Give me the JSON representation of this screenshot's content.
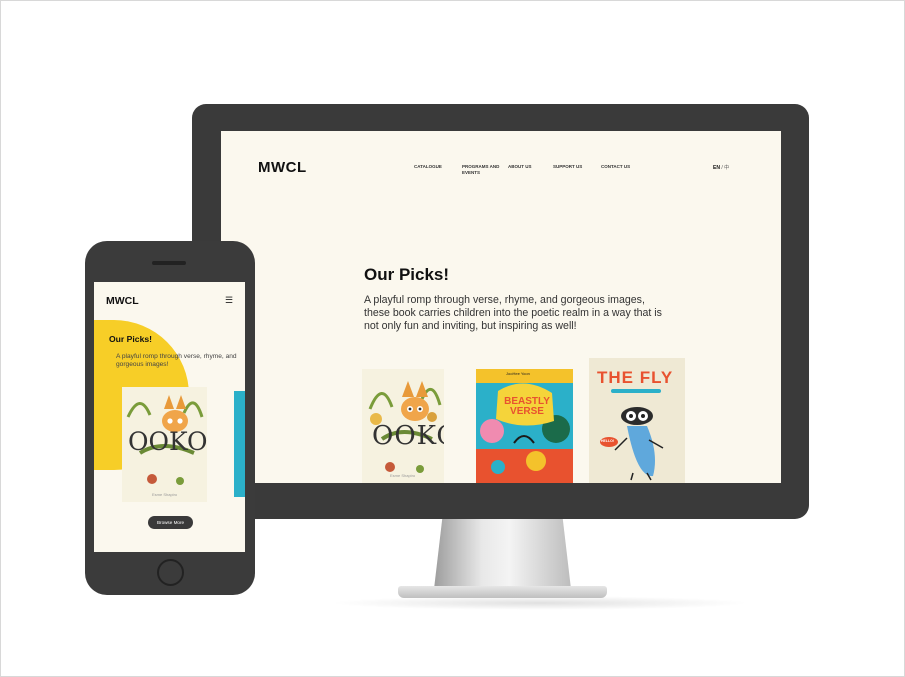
{
  "desktop": {
    "logo": "MWCL",
    "nav": [
      "CATALOGUE",
      "PROGRAMS AND EVENTS",
      "ABOUT US",
      "SUPPORT US",
      "CONTACT US"
    ],
    "lang_active": "EN",
    "lang_other": "/ 中",
    "title": "Our Picks!",
    "description": "A playful romp through verse, rhyme, and gorgeous images, these book carries children into the poetic realm in a way that is not only fun and inviting, but inspiring as well!",
    "books": [
      {
        "title": "OOKO",
        "author": "Esme Shapiro"
      },
      {
        "title": "BEASTLY VERSE",
        "author": "JooHee Yoon"
      },
      {
        "title": "THE FLY",
        "sticker": "HELLO!"
      }
    ]
  },
  "mobile": {
    "logo": "MWCL",
    "menu_icon": "☰",
    "title": "Our Picks!",
    "description": "A playful romp through verse, rhyme, and gorgeous images!",
    "book_title": "OOKO",
    "book_author": "Esme Shapiro",
    "button_label": "Browse More"
  },
  "colors": {
    "accent_yellow": "#f7ce27",
    "device_dark": "#3a3a3a",
    "screen_bg": "#fbf8ee"
  }
}
